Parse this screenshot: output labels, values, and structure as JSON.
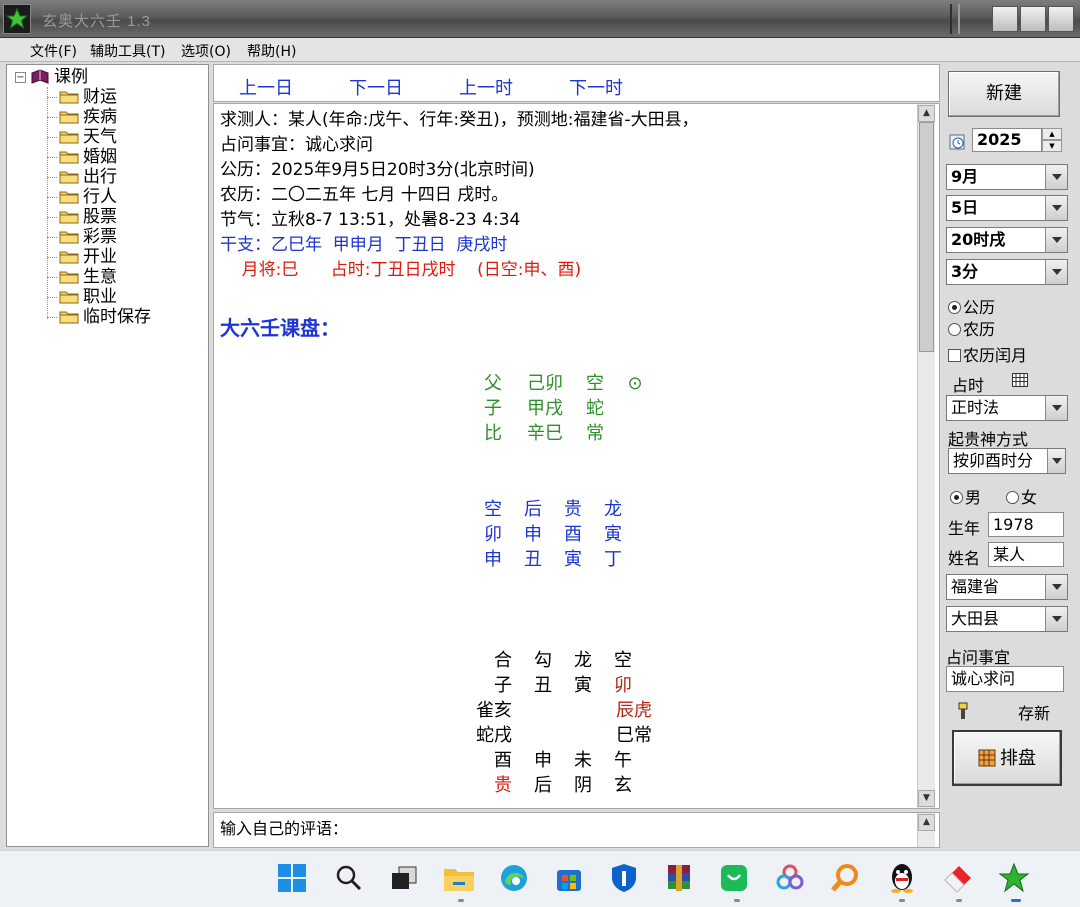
{
  "window": {
    "title": "玄奥大六壬 1.3"
  },
  "menu": [
    "文件(F)",
    "辅助工具(T)",
    "选项(O)",
    "帮助(H)"
  ],
  "tree": {
    "root": "课例",
    "items": [
      "财运",
      "疾病",
      "天气",
      "婚姻",
      "出行",
      "行人",
      "股票",
      "彩票",
      "开业",
      "生意",
      "职业",
      "临时保存"
    ]
  },
  "nav": {
    "prev_day": "上一日",
    "next_day": "下一日",
    "prev_hour": "上一时",
    "next_hour": "下一时"
  },
  "info": {
    "line1": "求测人：某人(年命:戊午、行年:癸丑)，预测地:福建省-大田县，",
    "line2": "占问事宜：诚心求问",
    "line3": "公历：2025年9月5日20时3分(北京时间)",
    "line4": "农历：二〇二五年 七月 十四日 戌时。",
    "line5": "节气：立秋8-7 13:51，处暑8-23 4:34",
    "line6": "干支：乙巳年  甲申月  丁丑日  庚戌时",
    "line7": "    月将:巳      占时:丁丑日戌时    (日空:申、酉)"
  },
  "heading": "大六壬课盘：",
  "chuan": {
    "rows": [
      [
        "父",
        "己卯",
        "空",
        "⊙"
      ],
      [
        "子",
        "甲戌",
        "蛇"
      ],
      [
        "比",
        "辛巳",
        "常"
      ]
    ]
  },
  "ke": {
    "row1": [
      "空",
      "后",
      "贵",
      "龙"
    ],
    "row2": [
      "卯",
      "申",
      "酉",
      "寅"
    ],
    "row3": [
      "申",
      "丑",
      "寅",
      "丁"
    ]
  },
  "tianpan": {
    "top_gods": [
      "合",
      "勾",
      "龙",
      "空"
    ],
    "top_branches": [
      "子",
      "丑",
      "寅",
      "卯"
    ],
    "left": [
      "雀亥",
      "蛇戌"
    ],
    "right": [
      "辰虎",
      "巳常"
    ],
    "bottom_branches": [
      "酉",
      "申",
      "未",
      "午"
    ],
    "bottom_gods": [
      "贵",
      "后",
      "阴",
      "玄"
    ]
  },
  "comment": {
    "placeholder": "输入自己的评语："
  },
  "right": {
    "new_button": "新建",
    "year": "2025",
    "month": "9月",
    "day": "5日",
    "hour": "20时戌",
    "minute": "3分",
    "calendar_solar": "公历",
    "calendar_lunar": "农历",
    "leap_month": "农历闰月",
    "zhan_shi_label": "占时",
    "zhan_shi_method": "正时法",
    "gui_label": "起贵神方式",
    "gui_method": "按卯酉时分",
    "male": "男",
    "female": "女",
    "birth_year_label": "生年",
    "birth_year": "1978",
    "name_label": "姓名",
    "name": "某人",
    "province": "福建省",
    "county": "大田县",
    "question_label": "占问事宜",
    "question": "诚心求问",
    "save_new": "存新",
    "arrange_button": "排盘"
  },
  "colors": {
    "blue": "#1c35d4",
    "red": "#e0190c",
    "dark_red": "#b42410",
    "green": "#2f8f2a"
  },
  "taskbar_icons": [
    "windows-start-icon",
    "search-icon",
    "task-view-icon",
    "file-explorer-icon",
    "edge-icon",
    "store-icon",
    "defender-icon",
    "winrar-icon",
    "wechat-icon",
    "colorful-app-icon",
    "magnifier-search-icon",
    "qq-penguin-icon",
    "eraser-app-icon",
    "app-star-icon"
  ]
}
